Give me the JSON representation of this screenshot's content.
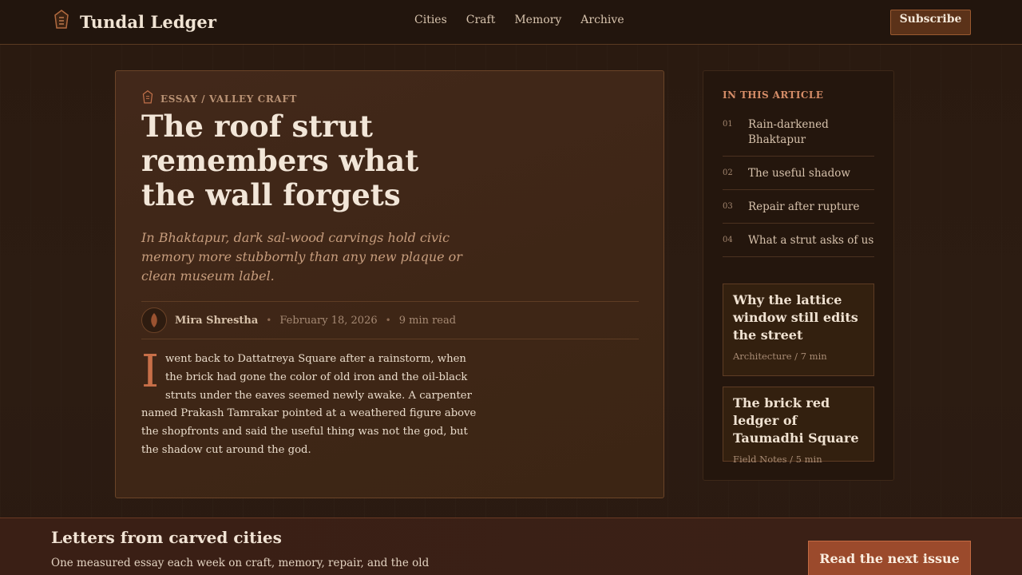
{
  "header": {
    "brand_title": "Tundal Ledger",
    "nav": [
      "Cities",
      "Craft",
      "Memory",
      "Archive"
    ],
    "subscribe_label": "Subscribe"
  },
  "article": {
    "kicker": "ESSAY / VALLEY CRAFT",
    "headline": "The roof strut remembers what the wall forgets",
    "dek": "In Bhaktapur, dark sal-wood carvings hold civic memory more stubbornly than any new plaque or clean museum label.",
    "author": "Mira Shrestha",
    "date": "February 18, 2026",
    "read_time": "9 min read",
    "dropcap": "I",
    "body": "went back to Dattatreya Square after a rainstorm, when the brick had gone the color of old iron and the oil-black struts under the eaves seemed newly awake. A carpenter named Prakash Tamrakar pointed at a weathered figure above the shopfronts and said the useful thing was not the god, but the shadow cut around the god."
  },
  "sidebar": {
    "toc_title": "IN THIS ARTICLE",
    "toc": [
      {
        "num": "01",
        "label": "Rain-darkened Bhaktapur"
      },
      {
        "num": "02",
        "label": "The useful shadow"
      },
      {
        "num": "03",
        "label": "Repair after rupture"
      },
      {
        "num": "04",
        "label": "What a strut asks of us"
      }
    ],
    "related": [
      {
        "title": "Why the lattice window still edits the street",
        "meta": "Architecture / 7 min"
      },
      {
        "title": "The brick red ledger of Taumadhi Square",
        "meta": "Field Notes / 5 min"
      }
    ]
  },
  "footer": {
    "title": "Letters from carved cities",
    "subtitle": "One measured essay each week on craft, memory, repair, and the old",
    "cta_label": "Read the next issue"
  },
  "colors": {
    "accent": "#c86f48",
    "cta": "#9b4a2c"
  }
}
